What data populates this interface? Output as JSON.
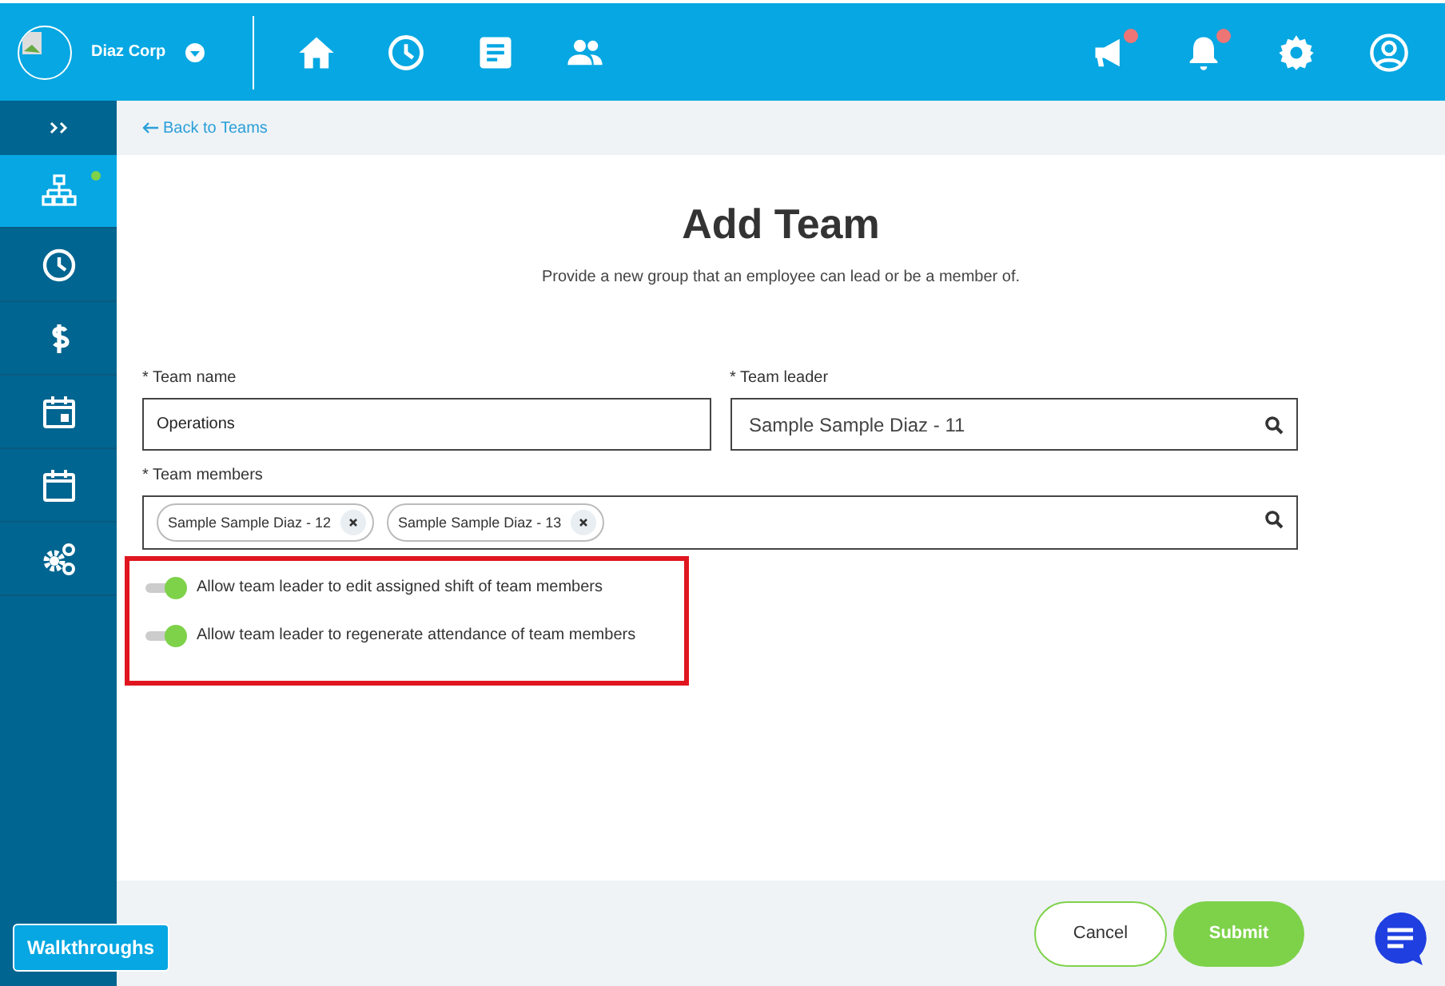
{
  "header": {
    "company": "Diaz Corp",
    "nav": [
      {
        "kind": "home"
      },
      {
        "kind": "clock"
      },
      {
        "kind": "doc"
      },
      {
        "kind": "people"
      }
    ],
    "actions": [
      {
        "kind": "megaphone",
        "alert": true
      },
      {
        "kind": "bell",
        "alert": true
      },
      {
        "kind": "gear",
        "alert": false
      },
      {
        "kind": "user",
        "alert": false
      }
    ]
  },
  "sidebar": {
    "items": [
      {
        "kind": "org",
        "selected": true,
        "alert": true
      },
      {
        "kind": "clock",
        "selected": false,
        "alert": false
      },
      {
        "kind": "dollar",
        "selected": false,
        "alert": false
      },
      {
        "kind": "calendar-day",
        "selected": false,
        "alert": false
      },
      {
        "kind": "calendar",
        "selected": false,
        "alert": false
      },
      {
        "kind": "gears",
        "selected": false,
        "alert": false
      }
    ]
  },
  "back_link": "Back to Teams",
  "title": "Add Team",
  "subtitle": "Provide a new group that an employee can lead or be a member of.",
  "team_name": {
    "label": "* Team name",
    "value": "Operations"
  },
  "team_leader": {
    "label": "* Team leader",
    "value": "Sample Sample Diaz - 11"
  },
  "team_members": {
    "label": "* Team members",
    "chips": [
      "Sample Sample Diaz - 12",
      "Sample Sample Diaz - 13"
    ]
  },
  "toggles": [
    {
      "label": "Allow team leader to edit assigned shift of team members",
      "on": true
    },
    {
      "label": "Allow team leader to regenerate attendance of team members",
      "on": true
    }
  ],
  "buttons": {
    "cancel": "Cancel",
    "submit": "Submit"
  },
  "walkthroughs": "Walkthroughs"
}
